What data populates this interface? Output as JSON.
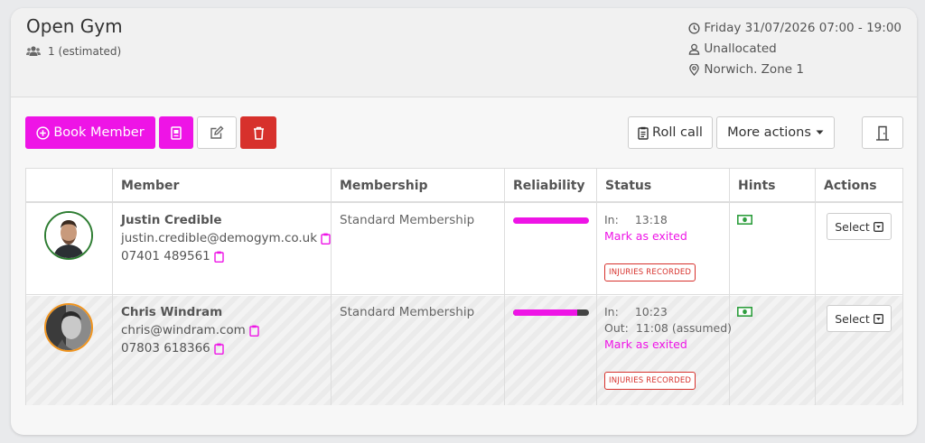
{
  "header": {
    "title": "Open Gym",
    "attendance": "1 (estimated)",
    "datetime": "Friday 31/07/2026 07:00 - 19:00",
    "instructor": "Unallocated",
    "location": "Norwich. Zone 1"
  },
  "toolbar": {
    "book_member": "Book Member",
    "roll_call": "Roll call",
    "more_actions": "More actions"
  },
  "table": {
    "columns": [
      "",
      "Member",
      "Membership",
      "Reliability",
      "Status",
      "Hints",
      "Actions"
    ],
    "rows": [
      {
        "name": "Justin Credible",
        "email": "justin.credible@demogym.co.uk",
        "phone": "07401 489561",
        "membership": "Standard Membership",
        "reliability": 1.0,
        "in_label": "In:",
        "in_time": "13:18",
        "mark_exit": "Mark as exited",
        "injury": "INJURIES RECORDED",
        "action": "Select"
      },
      {
        "name": "Chris Windram",
        "email": "chris@windram.com",
        "phone": "07803 618366",
        "membership": "Standard Membership",
        "reliability": 0.85,
        "in_label": "In:",
        "in_time": "10:23",
        "out_label": "Out:",
        "out_time": "11:08 (assumed)",
        "mark_exit": "Mark as exited",
        "injury": "INJURIES RECORDED",
        "action": "Select"
      }
    ]
  },
  "colors": {
    "accent": "#ee14e6",
    "danger": "#d7312c",
    "avatar_ring_1": "#2e7d32",
    "avatar_ring_2": "#f0941e",
    "hint_green": "#2e9e3e"
  }
}
